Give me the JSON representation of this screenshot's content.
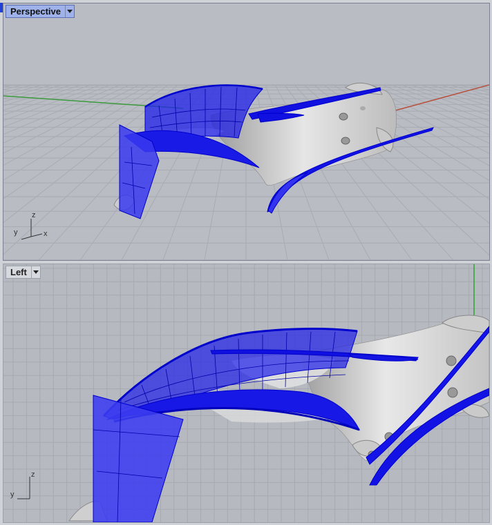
{
  "viewports": {
    "perspective": {
      "label": "Perspective",
      "axes": {
        "x": "x",
        "y": "y",
        "z": "z"
      }
    },
    "left": {
      "label": "Left",
      "axes": {
        "y": "y",
        "z": "z"
      }
    }
  },
  "colors": {
    "viewport_background": "#b9bdc3",
    "grid_line": "#a7abb1",
    "x_axis": "#b8503d",
    "y_axis": "#3b9a3b",
    "z_axis": "#2fa52f",
    "surface_blue": "#1010e0",
    "mesh_gray": "#d8d8d8",
    "active_tab": "#9fb3ea"
  }
}
